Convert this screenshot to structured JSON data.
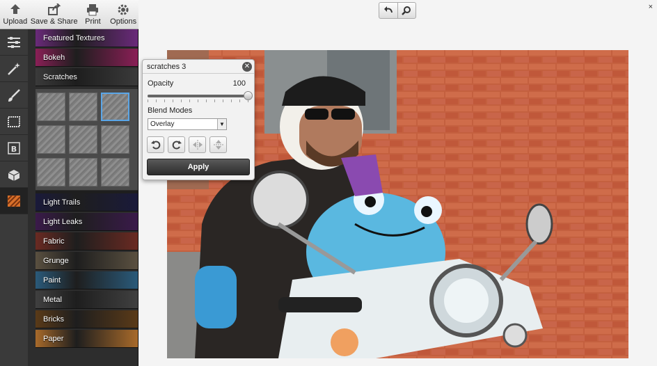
{
  "toolbar": {
    "items": [
      {
        "label": "Upload",
        "icon": "upload-arrow-icon"
      },
      {
        "label": "Save & Share",
        "icon": "share-icon"
      },
      {
        "label": "Print",
        "icon": "printer-icon"
      },
      {
        "label": "Options",
        "icon": "gear-icon"
      }
    ]
  },
  "rail": {
    "items": [
      {
        "icon": "adjustments-sliders-icon"
      },
      {
        "icon": "magic-wand-icon"
      },
      {
        "icon": "paintbrush-icon"
      },
      {
        "icon": "frame-icon"
      },
      {
        "icon": "text-b-icon"
      },
      {
        "icon": "sticker-box-icon"
      },
      {
        "icon": "textures-icon",
        "active": true
      }
    ]
  },
  "textures": {
    "categories_top": [
      {
        "label": "Featured Textures",
        "color": "#6a2a7a"
      },
      {
        "label": "Bokeh",
        "color": "#8a1f56"
      },
      {
        "label": "Scratches",
        "color": "#3a3a3a"
      }
    ],
    "scratches_thumbs_selected": 2,
    "categories_bottom": [
      {
        "label": "Light Trails",
        "color": "#1a1a3a"
      },
      {
        "label": "Light Leaks",
        "color": "#3a1a4a"
      },
      {
        "label": "Fabric",
        "color": "#6a2a22"
      },
      {
        "label": "Grunge",
        "color": "#5a5040"
      },
      {
        "label": "Paint",
        "color": "#2a5a7a"
      },
      {
        "label": "Metal",
        "color": "#404040"
      },
      {
        "label": "Bricks",
        "color": "#5a3a18"
      },
      {
        "label": "Paper",
        "color": "#a86a2a"
      }
    ]
  },
  "popup": {
    "title": "scratches 3",
    "opacity_label": "Opacity",
    "opacity_value": "100",
    "opacity_fraction": 1.0,
    "blend_label": "Blend Modes",
    "blend_value": "Overlay",
    "apply_label": "Apply"
  },
  "controls": {
    "close_symbol": "×"
  },
  "colors": {
    "accent_selected": "#5aa6e8",
    "panel_dark": "#2d2d2d"
  }
}
